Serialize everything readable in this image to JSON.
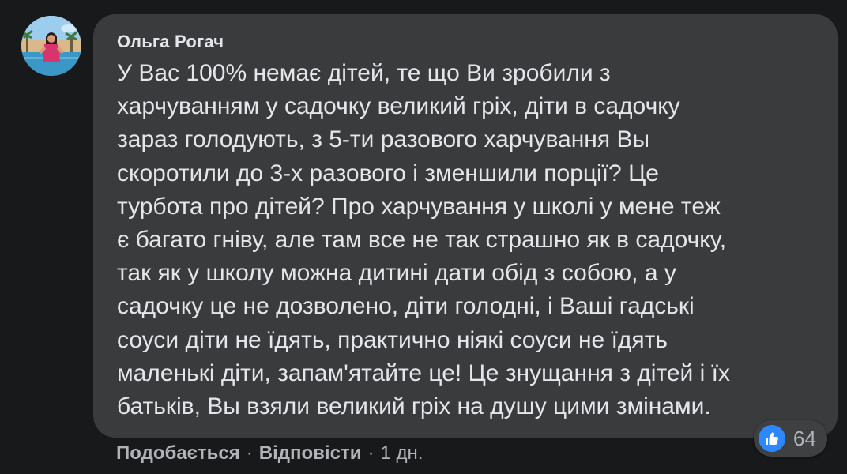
{
  "comment": {
    "author": "Ольга Рогач",
    "text": "У Вас 100% немає дітей, те що Ви зробили з\nхарчуванням у садочку великий гріх, діти в садочку\nзараз голодують, з 5-ти разового харчування Вы\nскоротили до 3-х разового і зменшили порції? Це\nтурбота про дітей? Про харчування у школі у мене теж\nє багато гніву, але там все не так страшно як в садочку,\nтак як у школу можна дитині дати обід з собою, а у\nсадочку це не дозволено, діти голодні, і Ваші гадські\nсоуси діти не їдять, практично ніякі соуси не їдять\nмаленькі діти, запам'ятайте це! Це знущання з дітей і їх\nбатьків, Вы взяли великий гріх на душу цими змінами.",
    "reactions": {
      "icon": "like-icon",
      "count": "64",
      "color": "#2d88ff"
    },
    "actions": {
      "like_label": "Подобається",
      "separator": "·",
      "reply_label": "Відповісти",
      "time": "1 дн."
    }
  },
  "theme": {
    "background": "#18191a",
    "bubble": "#3a3b3c",
    "primary_text": "#e4e6eb",
    "secondary_text": "#b0b3b8"
  }
}
